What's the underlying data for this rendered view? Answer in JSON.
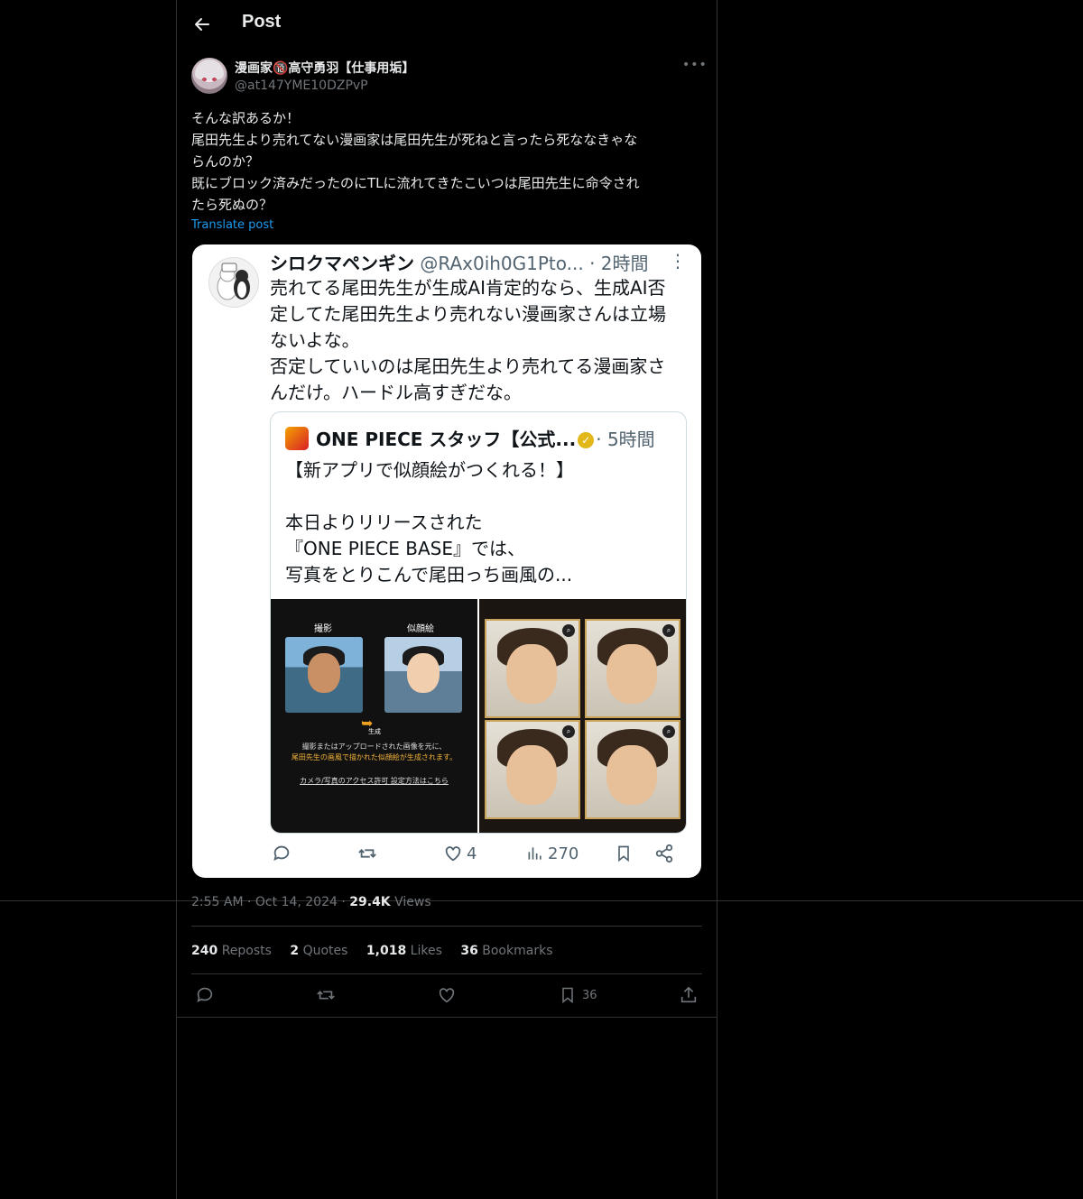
{
  "header": {
    "title": "Post"
  },
  "author": {
    "display_name": "漫画家🔞高守勇羽【仕事用垢】",
    "handle": "@at147YME10DZPvP"
  },
  "post": {
    "lines": [
      "そんな訳あるか！",
      "尾田先生より売れてない漫画家は尾田先生が死ねと言ったら死ななきゃな",
      "らんのか？",
      "既にブロック済みだったのにTLに流れてきたこいつは尾田先生に命令され",
      "たら死ぬの？"
    ],
    "translate_label": "Translate post"
  },
  "embed": {
    "quote": {
      "name": "シロクマペンギン",
      "handle": "@RAx0ih0G1Pto...",
      "time": "· 2時間",
      "lines": [
        "売れてる尾田先生が生成AI肯定的なら、生成AI否",
        "定してた尾田先生より売れない漫画家さんは立場",
        "ないよな。",
        "否定していいのは尾田先生より売れてる漫画家さ",
        "んだけ。ハードル高すぎだな。"
      ]
    },
    "inner": {
      "name": "ONE PIECE スタッフ【公式...",
      "time": "· 5時間",
      "lines": [
        "【新アプリで似顔絵がつくれる！】",
        "",
        "本日よりリリースされた",
        "『ONE PIECE BASE』では、",
        "写真をとりこんで尾田っち画風の..."
      ],
      "image_left": {
        "label_photo": "撮影",
        "label_portrait": "似顔絵",
        "label_generate": "生成",
        "caption1": "撮影またはアップロードされた画像を元に、",
        "caption2": "尾田先生の画風で描かれた似顔絵が生成されます。",
        "caption3": "カメラ/写真のアクセス許可 設定方法はこちら"
      }
    },
    "actions": {
      "likes": "4",
      "views": "270"
    }
  },
  "meta": {
    "time": "2:55 AM",
    "date": "Oct 14, 2024",
    "views_count": "29.4K",
    "views_label": "Views"
  },
  "stats": {
    "reposts_count": "240",
    "reposts_label": "Reposts",
    "quotes_count": "2",
    "quotes_label": "Quotes",
    "likes_count": "1,018",
    "likes_label": "Likes",
    "bookmarks_count": "36",
    "bookmarks_label": "Bookmarks"
  },
  "actions": {
    "bookmark_count": "36"
  },
  "colors": {
    "background": "#000000",
    "text": "#e7e9ea",
    "muted": "#71767b",
    "link": "#1d9bf0",
    "border": "#2f3336"
  },
  "icons": [
    "back-arrow-icon",
    "more-icon",
    "reply-icon",
    "repost-icon",
    "like-icon",
    "views-icon",
    "bookmark-icon",
    "share-icon",
    "verified-icon"
  ]
}
